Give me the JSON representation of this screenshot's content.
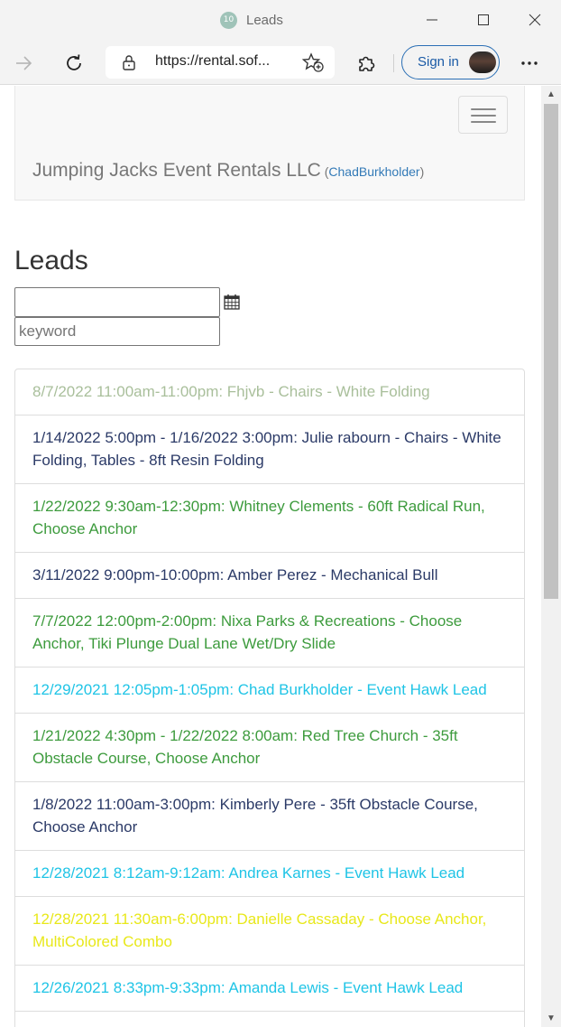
{
  "browser": {
    "tab_title": "Leads",
    "favicon_text": "10",
    "url": "https://rental.sof...",
    "signin_label": "Sign in"
  },
  "navbar": {
    "brand": "Jumping Jacks Event Rentals LLC",
    "user_open": " (",
    "user": "ChadBurkholder",
    "user_close": ")"
  },
  "page": {
    "heading": "Leads",
    "date_value": "",
    "keyword_placeholder": "keyword"
  },
  "colors": {
    "muted_green": "#a9bf9b",
    "navy": "#2b3a67",
    "green": "#3d9b3d",
    "cyan": "#1fc4e6",
    "yellow": "#e8e81a",
    "link": "#337ab7"
  },
  "leads": [
    {
      "text": "8/7/2022 11:00am-11:00pm: Fhjvb - Chairs - White Folding",
      "color": "#a9bf9b"
    },
    {
      "text": "1/14/2022 5:00pm - 1/16/2022 3:00pm: Julie rabourn - Chairs - White Folding, Tables - 8ft Resin Folding",
      "color": "#2b3a67"
    },
    {
      "text": "1/22/2022 9:30am-12:30pm: Whitney Clements - 60ft Radical Run, Choose Anchor",
      "color": "#3d9b3d"
    },
    {
      "text": "3/11/2022 9:00pm-10:00pm: Amber Perez - Mechanical Bull",
      "color": "#2b3a67"
    },
    {
      "text": "7/7/2022 12:00pm-2:00pm: Nixa Parks & Recreations - Choose Anchor, Tiki Plunge Dual Lane Wet/Dry Slide",
      "color": "#3d9b3d"
    },
    {
      "text": "12/29/2021 12:05pm-1:05pm: Chad Burkholder - Event Hawk Lead",
      "color": "#1fc4e6"
    },
    {
      "text": "1/21/2022 4:30pm - 1/22/2022 8:00am: Red Tree Church - 35ft Obstacle Course, Choose Anchor",
      "color": "#3d9b3d"
    },
    {
      "text": "1/8/2022 11:00am-3:00pm: Kimberly Pere - 35ft Obstacle Course, Choose Anchor",
      "color": "#2b3a67"
    },
    {
      "text": "12/28/2021 8:12am-9:12am: Andrea Karnes - Event Hawk Lead",
      "color": "#1fc4e6"
    },
    {
      "text": "12/28/2021 11:30am-6:00pm: Danielle Cassaday - Choose Anchor, MultiColored Combo",
      "color": "#e8e81a"
    },
    {
      "text": "12/26/2021 8:33pm-9:33pm: Amanda Lewis - Event Hawk Lead",
      "color": "#1fc4e6"
    },
    {
      "text": "",
      "color": "#2b3a67"
    }
  ]
}
